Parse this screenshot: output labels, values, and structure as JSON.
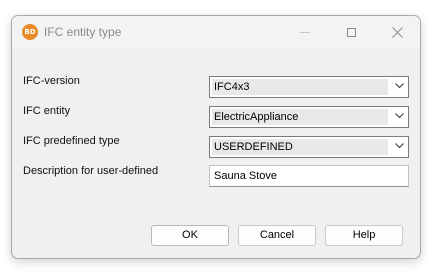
{
  "window": {
    "icon_text": "BD",
    "title": "IFC entity type"
  },
  "titlebar_buttons": {
    "minimize": "minimize-icon",
    "maximize": "maximize-icon",
    "close": "close-icon"
  },
  "form": {
    "ifc_version": {
      "label": "IFC-version",
      "value": "IFC4x3"
    },
    "ifc_entity": {
      "label": "IFC entity",
      "value": "ElectricAppliance"
    },
    "ifc_predefined_type": {
      "label": "IFC predefined type",
      "value": "USERDEFINED"
    },
    "description": {
      "label": "Description for user-defined",
      "value": "Sauna Stove"
    }
  },
  "buttons": {
    "ok": "OK",
    "cancel": "Cancel",
    "help": "Help"
  },
  "colors": {
    "app_icon": "#e98b29",
    "dialog_bg": "#f0f0f0"
  }
}
